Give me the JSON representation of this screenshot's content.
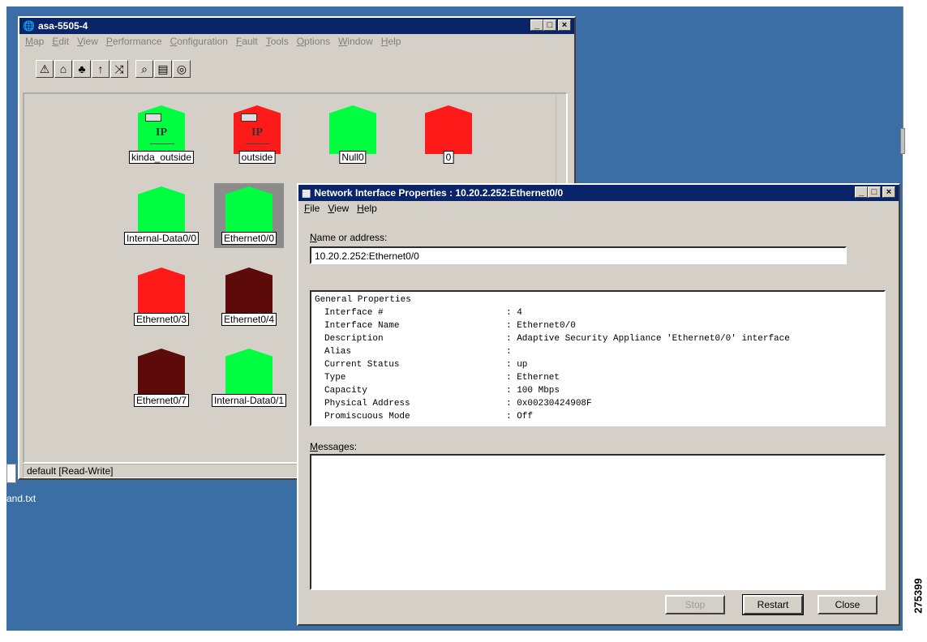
{
  "desktop": {
    "file_label": "and.txt",
    "watermark": "275399"
  },
  "main_window": {
    "title": "asa-5505-4",
    "menu": [
      "Map",
      "Edit",
      "View",
      "Performance",
      "Configuration",
      "Fault",
      "Tools",
      "Options",
      "Window",
      "Help"
    ],
    "toolbar_icons": [
      "submap-up-icon",
      "home-icon",
      "network-icon",
      "up-arrow-icon",
      "route-icon",
      "search-icon",
      "network-device-icon",
      "ip-map-icon"
    ],
    "nodes": [
      {
        "label": "kinda_outside",
        "status": "green",
        "ip": true
      },
      {
        "label": "outside",
        "status": "red",
        "ip": true
      },
      {
        "label": "Null0",
        "status": "green"
      },
      {
        "label": "0",
        "status": "red"
      },
      {
        "label": "Internal-Data0/0",
        "status": "green"
      },
      {
        "label": "Ethernet0/0",
        "status": "green",
        "selected": true
      },
      {
        "label": "Ethernet0/3",
        "status": "red"
      },
      {
        "label": "Ethernet0/4",
        "status": "dark"
      },
      {
        "label": "Ethernet0/7",
        "status": "dark"
      },
      {
        "label": "Internal-Data0/1",
        "status": "green"
      }
    ],
    "ip_text": "IP",
    "status": "default [Read-Write]"
  },
  "dialog": {
    "title": "Network Interface Properties : 10.20.2.252:Ethernet0/0",
    "menu": [
      "File",
      "View",
      "Help"
    ],
    "name_label": "Name or address:",
    "name_value": "10.20.2.252:Ethernet0/0",
    "props_header": "General Properties",
    "props": [
      {
        "k": "Interface #",
        "v": ": 4"
      },
      {
        "k": "Interface Name",
        "v": ": Ethernet0/0"
      },
      {
        "k": "Description",
        "v": ": Adaptive Security Appliance 'Ethernet0/0' interface"
      },
      {
        "k": "Alias",
        "v": ":"
      },
      {
        "k": "Current Status",
        "v": ": up"
      },
      {
        "k": "Type",
        "v": ": Ethernet"
      },
      {
        "k": "Capacity",
        "v": ": 100 Mbps"
      },
      {
        "k": "Physical Address",
        "v": ": 0x00230424908F"
      },
      {
        "k": "Promiscuous Mode",
        "v": ": Off"
      }
    ],
    "messages_label": "Messages:",
    "buttons": {
      "stop": "Stop",
      "restart": "Restart",
      "close": "Close"
    }
  }
}
